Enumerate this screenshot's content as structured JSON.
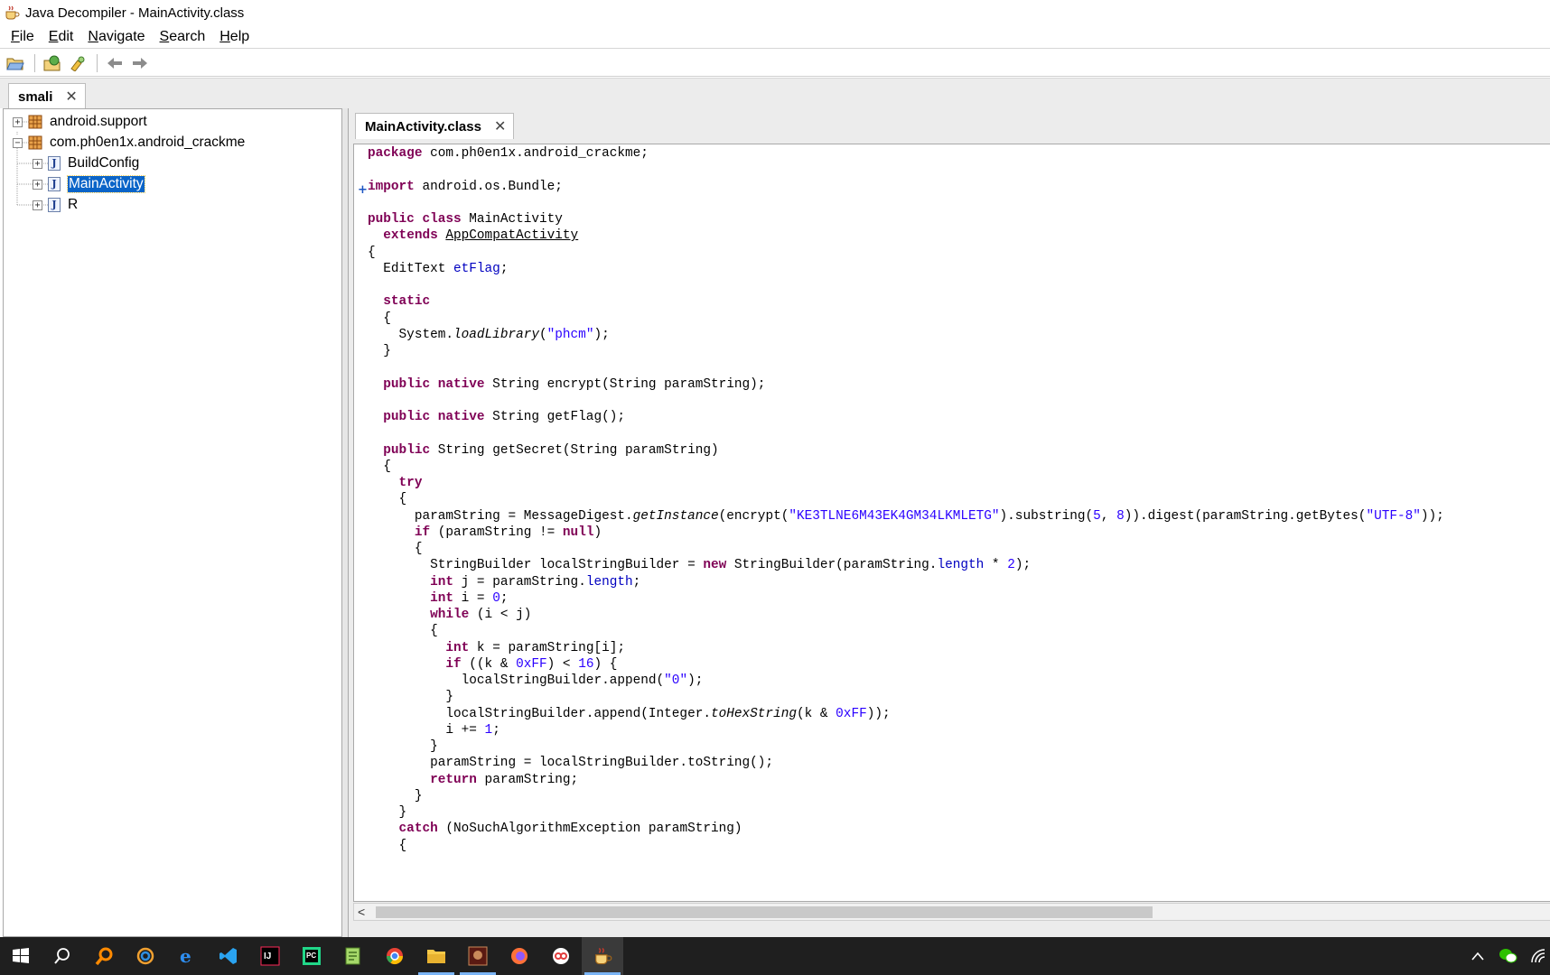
{
  "window": {
    "title": "Java Decompiler - MainActivity.class",
    "icon": "coffee-cup-icon"
  },
  "menu": [
    {
      "key": "F",
      "rest": "ile"
    },
    {
      "key": "E",
      "rest": "dit"
    },
    {
      "key": "N",
      "rest": "avigate"
    },
    {
      "key": "S",
      "rest": "earch"
    },
    {
      "key": "H",
      "rest": "elp"
    }
  ],
  "toolbar": {
    "buttons": [
      "open-file-icon",
      "open-type-icon",
      "find-icon",
      "back-arrow-icon",
      "forward-arrow-icon"
    ]
  },
  "left_tab": {
    "label": "smali",
    "close": "✕"
  },
  "tree": {
    "items": [
      {
        "label": "android.support",
        "expander": "+",
        "icon": "package-icon",
        "depth": 0
      },
      {
        "label": "com.ph0en1x.android_crackme",
        "expander": "−",
        "icon": "package-icon",
        "depth": 0
      },
      {
        "label": "BuildConfig",
        "expander": "+",
        "icon": "class-file-icon",
        "depth": 1
      },
      {
        "label": "MainActivity",
        "expander": "+",
        "icon": "class-file-icon",
        "depth": 1,
        "selected": true
      },
      {
        "label": "R",
        "expander": "+",
        "icon": "class-file-icon",
        "depth": 1
      }
    ],
    "class_glyph": "J"
  },
  "editor_tab": {
    "label": "MainActivity.class",
    "close": "✕"
  },
  "editor": {
    "fold_marker": "+",
    "scroll_left": "<"
  },
  "code_lines": [
    [
      [
        "kw",
        "package"
      ],
      [
        "t",
        " com.ph0en1x.android_crackme;"
      ]
    ],
    [],
    [
      [
        "kw",
        "import"
      ],
      [
        "t",
        " android.os.Bundle;"
      ]
    ],
    [],
    [
      [
        "kw",
        "public class"
      ],
      [
        "t",
        " MainActivity"
      ]
    ],
    [
      [
        "t",
        "  "
      ],
      [
        "kw",
        "extends"
      ],
      [
        "t",
        " "
      ],
      [
        "ul",
        "AppCompatActivity"
      ]
    ],
    [
      [
        "t",
        "{"
      ]
    ],
    [
      [
        "t",
        "  EditText "
      ],
      [
        "fld",
        "etFlag"
      ],
      [
        "t",
        ";"
      ]
    ],
    [],
    [
      [
        "t",
        "  "
      ],
      [
        "kw",
        "static"
      ]
    ],
    [
      [
        "t",
        "  {"
      ]
    ],
    [
      [
        "t",
        "    System."
      ],
      [
        "itl",
        "loadLibrary"
      ],
      [
        "t",
        "("
      ],
      [
        "str",
        "\"phcm\""
      ],
      [
        "t",
        ");"
      ]
    ],
    [
      [
        "t",
        "  }"
      ]
    ],
    [],
    [
      [
        "t",
        "  "
      ],
      [
        "kw",
        "public native"
      ],
      [
        "t",
        " String encrypt(String paramString);"
      ]
    ],
    [],
    [
      [
        "t",
        "  "
      ],
      [
        "kw",
        "public native"
      ],
      [
        "t",
        " String getFlag();"
      ]
    ],
    [],
    [
      [
        "t",
        "  "
      ],
      [
        "kw",
        "public"
      ],
      [
        "t",
        " String getSecret(String paramString)"
      ]
    ],
    [
      [
        "t",
        "  {"
      ]
    ],
    [
      [
        "t",
        "    "
      ],
      [
        "kw",
        "try"
      ]
    ],
    [
      [
        "t",
        "    {"
      ]
    ],
    [
      [
        "t",
        "      paramString = MessageDigest."
      ],
      [
        "itl",
        "getInstance"
      ],
      [
        "t",
        "(encrypt("
      ],
      [
        "str",
        "\"KE3TLNE6M43EK4GM34LKMLETG\""
      ],
      [
        "t",
        ").substring("
      ],
      [
        "num",
        "5"
      ],
      [
        "t",
        ", "
      ],
      [
        "num",
        "8"
      ],
      [
        "t",
        ")).digest(paramString.getBytes("
      ],
      [
        "str",
        "\"UTF-8\""
      ],
      [
        "t",
        "));"
      ]
    ],
    [
      [
        "t",
        "      "
      ],
      [
        "kw",
        "if"
      ],
      [
        "t",
        " (paramString != "
      ],
      [
        "kw",
        "null"
      ],
      [
        "t",
        ")"
      ]
    ],
    [
      [
        "t",
        "      {"
      ]
    ],
    [
      [
        "t",
        "        StringBuilder localStringBuilder = "
      ],
      [
        "kw",
        "new"
      ],
      [
        "t",
        " StringBuilder(paramString."
      ],
      [
        "fld",
        "length"
      ],
      [
        "t",
        " * "
      ],
      [
        "num",
        "2"
      ],
      [
        "t",
        ");"
      ]
    ],
    [
      [
        "t",
        "        "
      ],
      [
        "kw",
        "int"
      ],
      [
        "t",
        " j = paramString."
      ],
      [
        "fld",
        "length"
      ],
      [
        "t",
        ";"
      ]
    ],
    [
      [
        "t",
        "        "
      ],
      [
        "kw",
        "int"
      ],
      [
        "t",
        " i = "
      ],
      [
        "num",
        "0"
      ],
      [
        "t",
        ";"
      ]
    ],
    [
      [
        "t",
        "        "
      ],
      [
        "kw",
        "while"
      ],
      [
        "t",
        " (i < j)"
      ]
    ],
    [
      [
        "t",
        "        {"
      ]
    ],
    [
      [
        "t",
        "          "
      ],
      [
        "kw",
        "int"
      ],
      [
        "t",
        " k = paramString[i];"
      ]
    ],
    [
      [
        "t",
        "          "
      ],
      [
        "kw",
        "if"
      ],
      [
        "t",
        " ((k & "
      ],
      [
        "num",
        "0xFF"
      ],
      [
        "t",
        ") < "
      ],
      [
        "num",
        "16"
      ],
      [
        "t",
        ") {"
      ]
    ],
    [
      [
        "t",
        "            localStringBuilder.append("
      ],
      [
        "str",
        "\"0\""
      ],
      [
        "t",
        ");"
      ]
    ],
    [
      [
        "t",
        "          }"
      ]
    ],
    [
      [
        "t",
        "          localStringBuilder.append(Integer."
      ],
      [
        "itl",
        "toHexString"
      ],
      [
        "t",
        "(k & "
      ],
      [
        "num",
        "0xFF"
      ],
      [
        "t",
        "));"
      ]
    ],
    [
      [
        "t",
        "          i += "
      ],
      [
        "num",
        "1"
      ],
      [
        "t",
        ";"
      ]
    ],
    [
      [
        "t",
        "        }"
      ]
    ],
    [
      [
        "t",
        "        paramString = localStringBuilder.toString();"
      ]
    ],
    [
      [
        "t",
        "        "
      ],
      [
        "kw",
        "return"
      ],
      [
        "t",
        " paramString;"
      ]
    ],
    [
      [
        "t",
        "      }"
      ]
    ],
    [
      [
        "t",
        "    }"
      ]
    ],
    [
      [
        "t",
        "    "
      ],
      [
        "kw",
        "catch"
      ],
      [
        "t",
        " (NoSuchAlgorithmException paramString)"
      ]
    ],
    [
      [
        "t",
        "    {"
      ]
    ]
  ],
  "taskbar": {
    "apps": [
      {
        "name": "start-button",
        "icon": "windows-logo-icon"
      },
      {
        "name": "search-button",
        "icon": "search-icon"
      },
      {
        "name": "everything-search",
        "icon": "magnifier-orange-icon"
      },
      {
        "name": "photo-app",
        "icon": "swirl-icon"
      },
      {
        "name": "ie-browser",
        "icon": "internet-explorer-icon"
      },
      {
        "name": "vscode",
        "icon": "vscode-icon"
      },
      {
        "name": "intellij",
        "icon": "intellij-icon"
      },
      {
        "name": "pycharm",
        "icon": "pycharm-icon"
      },
      {
        "name": "notepad-plus",
        "icon": "notepad-icon"
      },
      {
        "name": "chrome",
        "icon": "chrome-icon"
      },
      {
        "name": "file-explorer",
        "icon": "folder-icon",
        "running": true
      },
      {
        "name": "ida",
        "icon": "ida-icon",
        "running": true
      },
      {
        "name": "firefox",
        "icon": "firefox-icon"
      },
      {
        "name": "video-player",
        "icon": "player-icon"
      },
      {
        "name": "java-decompiler",
        "icon": "coffee-cup-icon",
        "running": true,
        "active": true
      }
    ],
    "tray": [
      "show-hidden-icons-chevron-icon",
      "wechat-icon",
      "network-icon"
    ]
  }
}
